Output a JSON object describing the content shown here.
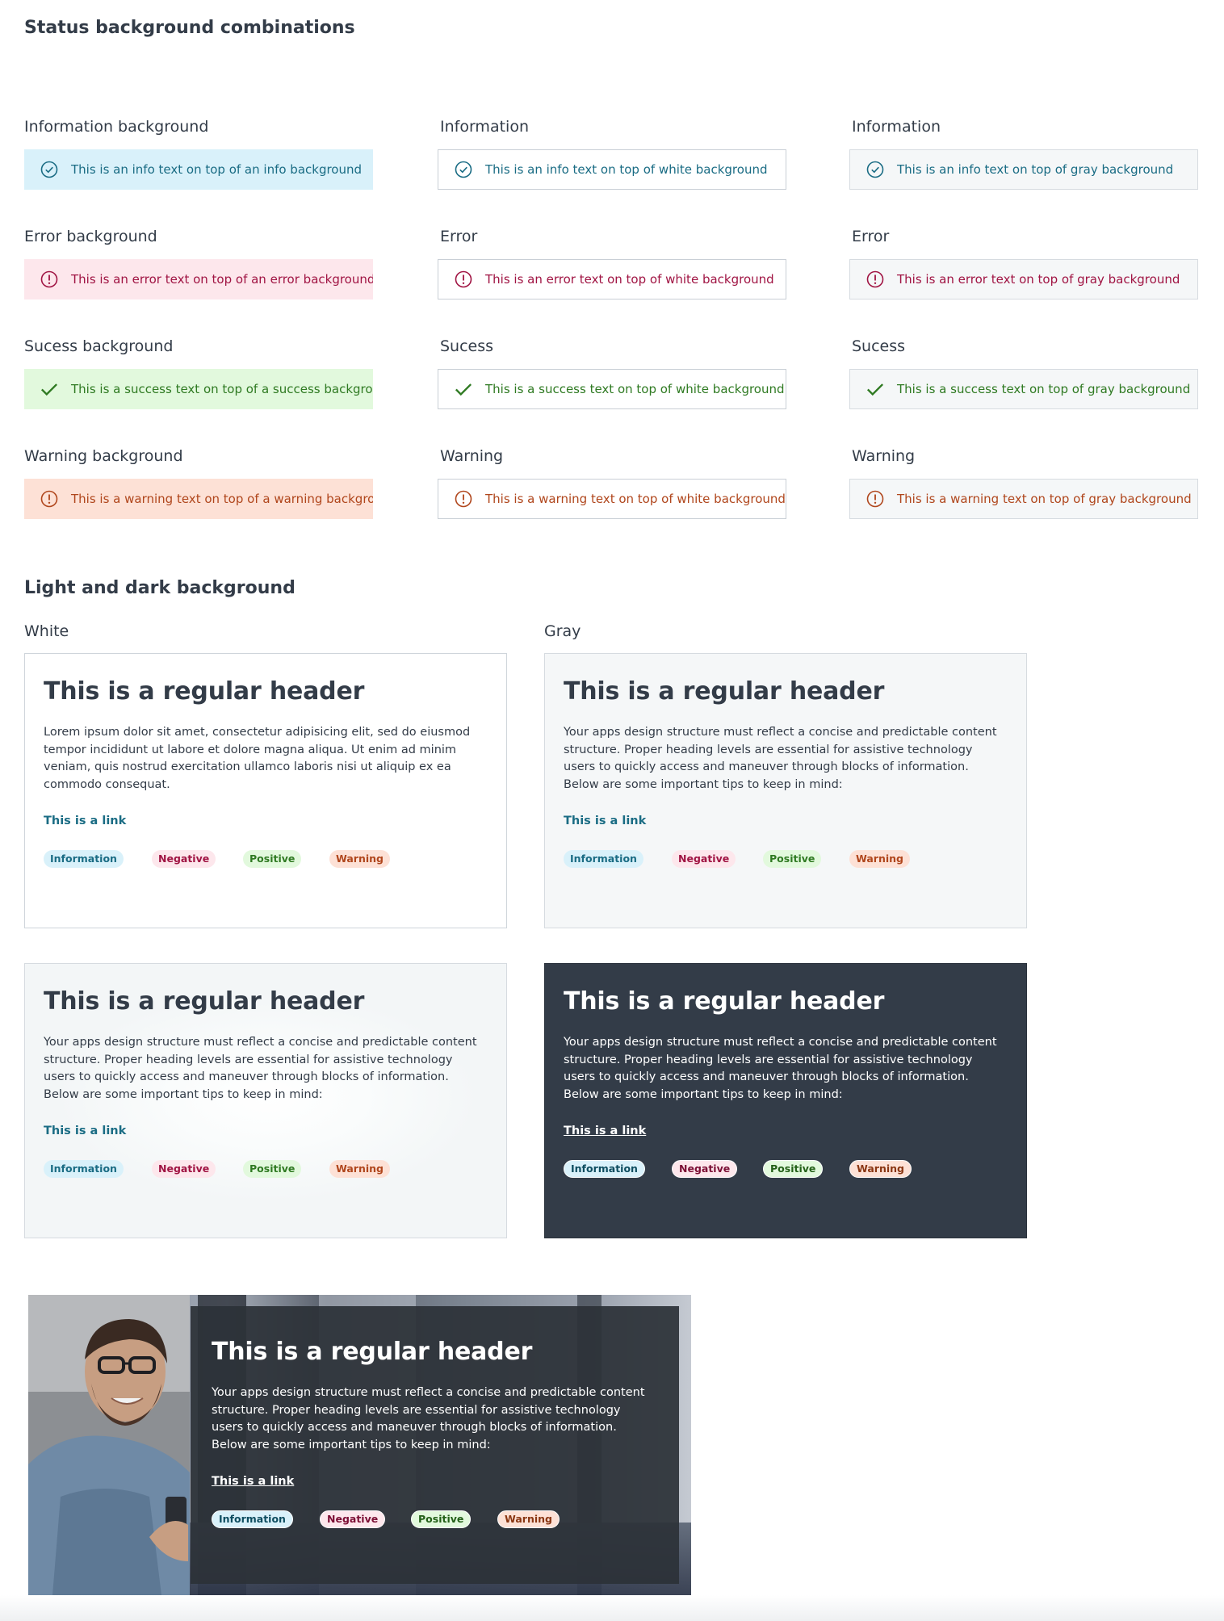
{
  "section1": {
    "title": "Status background combinations"
  },
  "columns": {
    "col1": [
      "Information background",
      "Error background",
      "Sucess background",
      "Warning background"
    ],
    "col2": [
      "Information",
      "Error",
      "Sucess",
      "Warning"
    ],
    "col3": [
      "Information",
      "Error",
      "Sucess",
      "Warning"
    ]
  },
  "alerts": {
    "info": [
      "This is an info text on top of an info background",
      "This is an info text on top of white background",
      "This is an info text on top of gray background"
    ],
    "error": [
      "This is an error text on top of an error background",
      "This is an error text on top of white background",
      "This is an error text on top of gray background"
    ],
    "success": [
      "This is a success text on top of a success background",
      "This is a success text on top of white background",
      "This is a success text on top of gray background"
    ],
    "warning": [
      "This is a warning text on top of a warning background",
      "This is a warning text on top of white background",
      "This is a warning text on top of gray background"
    ]
  },
  "section2": {
    "title": "Light and dark background",
    "white_label": "White",
    "gray_label": "Gray"
  },
  "cards": {
    "header": "This is a regular header",
    "lorem": "Lorem ipsum dolor sit amet, consectetur adipisicing elit, sed do eiusmod tempor incididunt ut labore et dolore magna aliqua. Ut enim ad minim veniam, quis nostrud exercitation ullamco laboris nisi ut aliquip ex ea commodo consequat.",
    "body": "Your apps design structure must reflect a concise and predictable content structure. Proper heading levels are essential for assistive technology users to quickly access and maneuver through blocks of information. Below are some important tips to keep in mind:",
    "link": "This is a link",
    "tags": {
      "info": "Information",
      "negative": "Negative",
      "positive": "Positive",
      "warning": "Warning"
    }
  },
  "colors": {
    "text": "#333c48",
    "info": "#1a6c84",
    "error": "#a01443",
    "success": "#2f7a22",
    "warning": "#b0461c",
    "dark_card": "#333c48"
  },
  "icons": {
    "info": "check-circle-icon",
    "error": "exclamation-circle-icon",
    "success": "checkmark-icon",
    "warning": "exclamation-circle-icon"
  }
}
